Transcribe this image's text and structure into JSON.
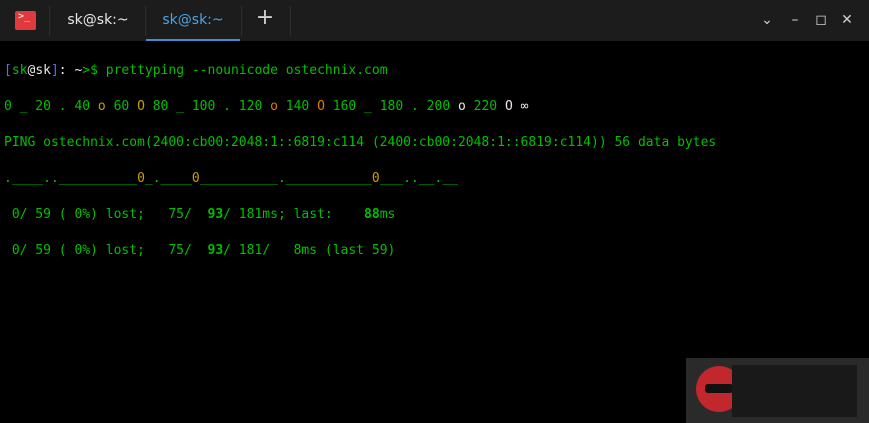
{
  "window": {
    "app_icon_glyph": ">_",
    "tabs": [
      {
        "label": "sk@sk:~",
        "active": false
      },
      {
        "label": "sk@sk:~",
        "active": true
      }
    ],
    "new_tab_glyph": "+",
    "controls": {
      "collapse": "⌄",
      "minimize": "–",
      "maximize": "◻",
      "close": "✕"
    }
  },
  "terminal": {
    "prompt": {
      "bracket_open": "[",
      "user": "sk",
      "at": "@",
      "host": "sk",
      "bracket_close": "]",
      "colon": ": ",
      "path": "~",
      "symbol": ">$",
      "command": " prettyping --nounicode ostechnix.com"
    },
    "scale": [
      {
        "t": "0 _ 20 . 40 ",
        "c": "g"
      },
      {
        "t": "o",
        "c": "y"
      },
      {
        "t": " 60 ",
        "c": "g"
      },
      {
        "t": "O",
        "c": "y"
      },
      {
        "t": " 80 _ 100 . 120 ",
        "c": "g"
      },
      {
        "t": "o",
        "c": "o"
      },
      {
        "t": " 140 ",
        "c": "g"
      },
      {
        "t": "O",
        "c": "o"
      },
      {
        "t": " 160 _ 180 . 200 ",
        "c": "g"
      },
      {
        "t": "o",
        "c": "w"
      },
      {
        "t": " 220 ",
        "c": "g"
      },
      {
        "t": "O",
        "c": "w"
      },
      {
        "t": " ∞",
        "c": "w"
      }
    ],
    "ping_header": "PING ostechnix.com(2400:cb00:2048:1::6819:c114 (2400:cb00:2048:1::6819:c114)) 56 data bytes",
    "graph": [
      {
        "t": ".____..__________",
        "c": "g"
      },
      {
        "t": "0",
        "c": "y"
      },
      {
        "t": "_.____",
        "c": "g"
      },
      {
        "t": "0",
        "c": "y"
      },
      {
        "t": "__________.___________",
        "c": "g"
      },
      {
        "t": "0",
        "c": "y"
      },
      {
        "t": "___..__.__",
        "c": "g"
      }
    ],
    "stats": [
      {
        "sent": " 0/ 59 ( 0%) lost;   75/  ",
        "avg": "93",
        "rest": "/ 181ms; last:    ",
        "last": "88",
        "tail": "ms"
      },
      {
        "sent": " 0/ 59 ( 0%) lost;   75/  ",
        "avg": "93",
        "rest": "/ 181/   8ms (last 59)",
        "last": "",
        "tail": ""
      }
    ]
  }
}
